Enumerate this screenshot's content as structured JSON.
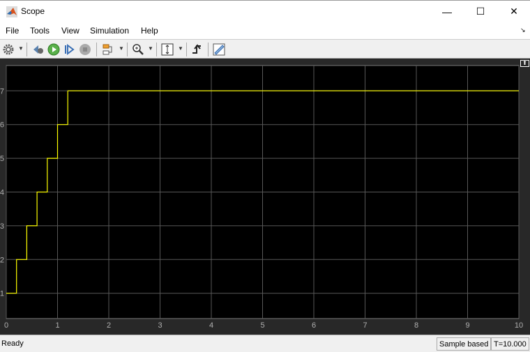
{
  "window": {
    "title": "Scope",
    "minimize": "—",
    "maximize": "☐",
    "close": "✕"
  },
  "menu": [
    "File",
    "Tools",
    "View",
    "Simulation",
    "Help"
  ],
  "toolbar": {
    "icons": [
      "gear-icon",
      "step-back-icon",
      "run-icon",
      "step-forward-icon",
      "stop-icon",
      "signal-hierarchy-icon",
      "zoom-in-icon",
      "scale-axes-icon",
      "triggers-icon",
      "cursor-measurements-icon"
    ]
  },
  "status": {
    "left": "Ready",
    "mode": "Sample based",
    "time": "T=10.000"
  },
  "colors": {
    "background": "#000000",
    "frame": "#282828",
    "grid": "#585858",
    "trace": "#ffff00",
    "ticks": "#b0b0b0"
  },
  "chart_data": {
    "type": "line",
    "step": true,
    "xlim": [
      0,
      10
    ],
    "ylim": [
      0.25,
      7.75
    ],
    "xticks": [
      0,
      1,
      2,
      3,
      4,
      5,
      6,
      7,
      8,
      9,
      10
    ],
    "yticks": [
      1,
      2,
      3,
      4,
      5,
      6,
      7
    ],
    "grid": true,
    "series": [
      {
        "x": [
          0,
          0.2,
          0.4,
          0.6,
          0.8,
          1.0,
          1.2,
          10
        ],
        "y": [
          1,
          2,
          3,
          4,
          5,
          6,
          7,
          7
        ]
      }
    ]
  }
}
